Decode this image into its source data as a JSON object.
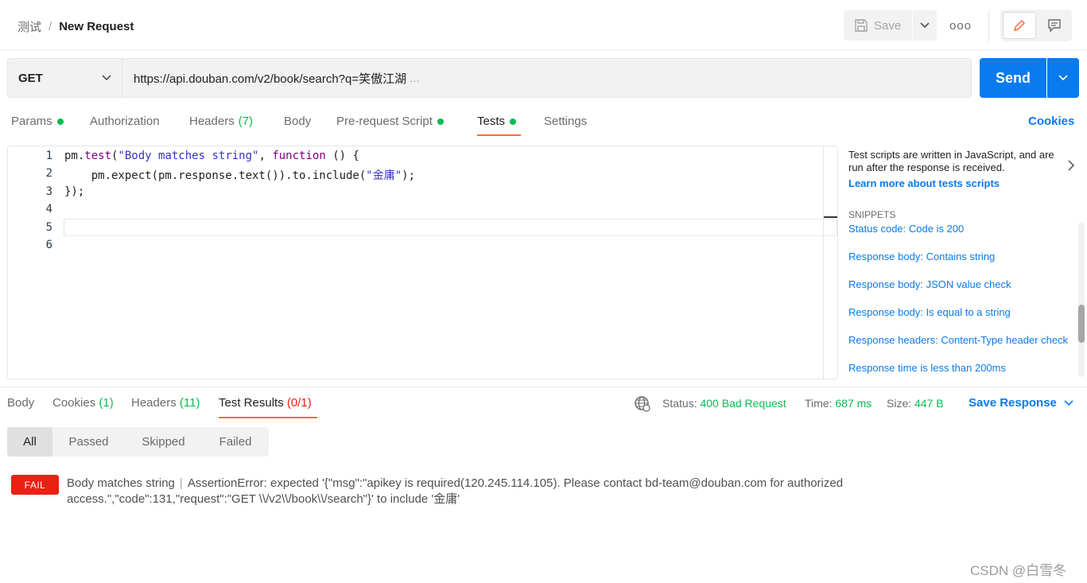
{
  "header": {
    "breadcrumb_parent": "测试",
    "breadcrumb_separator": "/",
    "breadcrumb_current": "New Request",
    "save_label": "Save",
    "more_label": "ooo"
  },
  "request": {
    "method": "GET",
    "url": "https://api.douban.com/v2/book/search?q=笑傲江湖",
    "url_ellipsis": "...",
    "send_label": "Send"
  },
  "tabs": {
    "params": "Params",
    "authorization": "Authorization",
    "headers": "Headers",
    "headers_count": "(7)",
    "body": "Body",
    "prerequest": "Pre-request Script",
    "tests": "Tests",
    "settings": "Settings",
    "cookies": "Cookies"
  },
  "editor": {
    "line_numbers": [
      "1",
      "2",
      "3",
      "4",
      "5",
      "6"
    ],
    "line1": {
      "a": "pm.",
      "b": "test",
      "c": "(",
      "d": "\"Body matches string\"",
      "e": ", ",
      "f": "function",
      "g": " () {"
    },
    "line2": {
      "a": "    pm.expect(pm.response.text()).to.include(",
      "b": "\"金庸\"",
      "c": ");"
    },
    "line3": "});"
  },
  "sidebar": {
    "description": "Test scripts are written in JavaScript, and are run after the response is received.",
    "learn_more": "Learn more about tests scripts",
    "snippets_title": "SNIPPETS",
    "snippets": [
      "Status code: Code is 200",
      "Response body: Contains string",
      "Response body: JSON value check",
      "Response body: Is equal to a string",
      "Response headers: Content-Type header check",
      "Response time is less than 200ms"
    ]
  },
  "response": {
    "tabs": {
      "body": "Body",
      "cookies": "Cookies",
      "cookies_count": "(1)",
      "headers": "Headers",
      "headers_count": "(11)",
      "test_results": "Test Results",
      "test_results_count": "(0/1)"
    },
    "status_label": "Status:",
    "status_value": "400 Bad Request",
    "time_label": "Time:",
    "time_value": "687 ms",
    "size_label": "Size:",
    "size_value": "447 B",
    "save_response": "Save Response",
    "filters": [
      "All",
      "Passed",
      "Skipped",
      "Failed"
    ],
    "result": {
      "badge": "FAIL",
      "name": "Body matches string",
      "separator": "|",
      "message": "AssertionError: expected '{\"msg\":\"apikey is required(120.245.114.105). Please contact bd-team@douban.com for authorized access.\",\"code\":131,\"request\":\"GET \\\\/v2\\\\/book\\\\/search\"}' to include '金庸'"
    }
  },
  "watermark": "CSDN @白雪冬",
  "colors": {
    "accent": "#ff6c37",
    "primary": "#097bed",
    "success": "#0cbb52",
    "error": "#eb2013"
  }
}
